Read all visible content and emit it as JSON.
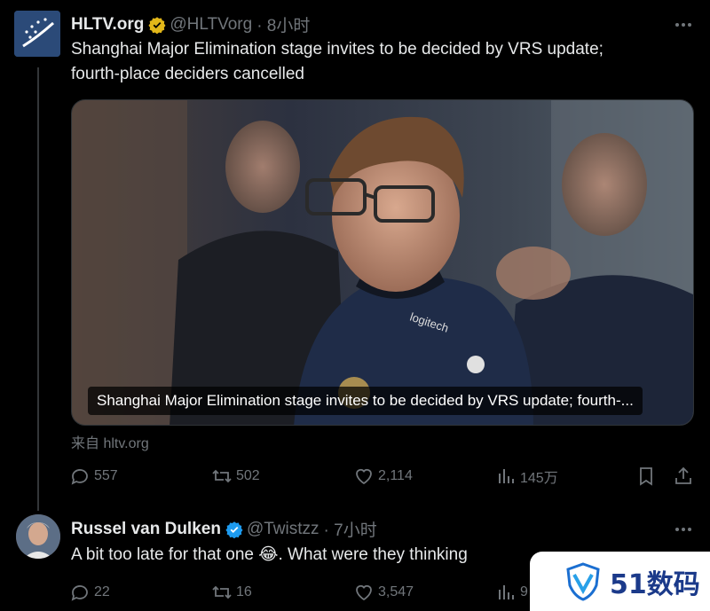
{
  "tweet": {
    "author_name": "HLTV.org",
    "handle": "@HLTVorg",
    "time": "· 8小时",
    "text_line1": "Shanghai Major Elimination stage invites to be decided by VRS update;",
    "text_line2": "fourth-place deciders cancelled",
    "card_caption": "Shanghai Major Elimination stage invites to be decided by VRS update; fourth-...",
    "source": "来自 hltv.org",
    "stats": {
      "replies": "557",
      "retweets": "502",
      "likes": "2,114",
      "views": "145万"
    }
  },
  "reply": {
    "author_name": "Russel van Dulken",
    "handle": "@Twistzz",
    "time": "· 7小时",
    "text_before_emoji": "A bit too late for that one ",
    "emoji": "😂",
    "text_after_emoji": ". What were they thinking",
    "stats": {
      "replies": "22",
      "retweets": "16",
      "likes": "3,547",
      "views": "9"
    }
  },
  "watermark": {
    "text": "51数码"
  },
  "colors": {
    "background": "#000000",
    "text": "#e7e9ea",
    "muted": "#71767b",
    "verified": "#1d9bf0",
    "gold_verified": "#e2b719"
  }
}
